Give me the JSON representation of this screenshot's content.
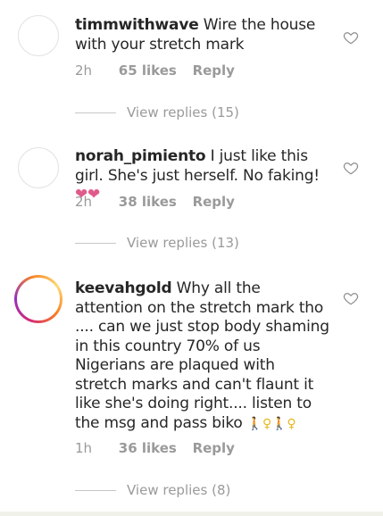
{
  "comments": [
    {
      "username": "timmwithwave",
      "text": "Wire the house with your stretch mark",
      "time": "2h",
      "likes": "65 likes",
      "reply_label": "Reply",
      "view_replies": "View replies (15)"
    },
    {
      "username": "norah_pimiento",
      "text": "I just like this girl. She's just herself. No faking!",
      "emoji": "❤❤",
      "time": "2h",
      "likes": "38 likes",
      "reply_label": "Reply",
      "view_replies": "View replies (13)"
    },
    {
      "username": "keevahgold",
      "text": "Why all the attention on the stretch mark tho .... can we just stop body shaming in this country 70% of us Nigerians are plaqued with stretch marks  and can't flaunt it like she's doing right.... listen to the msg and pass biko",
      "emoji": "🚶♀🚶♀",
      "time": "1h",
      "likes": "36 likes",
      "reply_label": "Reply",
      "view_replies": "View replies (8)"
    }
  ],
  "icons": {
    "like": "heart-outline-icon",
    "story_ring_colors": [
      "#d62976",
      "#962fbf",
      "#f58529",
      "#feda75"
    ]
  },
  "colors": {
    "text": "#262626",
    "secondary": "#9a9a9a",
    "emoji_heart": "#e05a8c"
  }
}
